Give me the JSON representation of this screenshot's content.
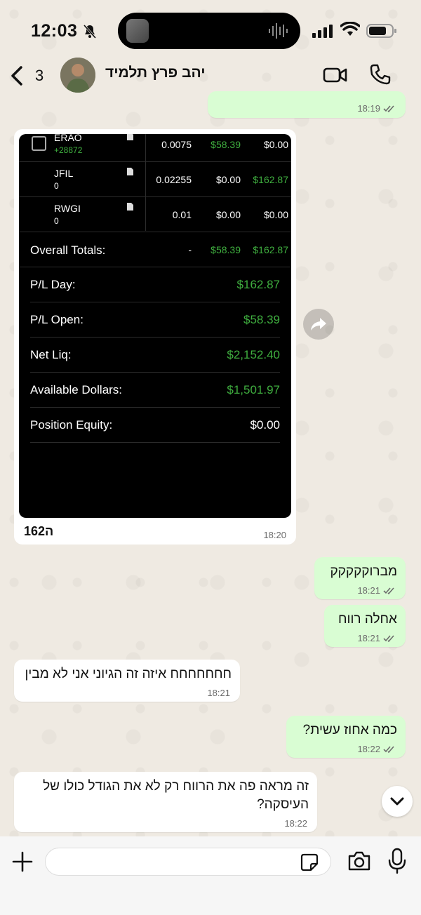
{
  "status_bar": {
    "time": "12:03"
  },
  "header": {
    "back_count": "3",
    "contact_name": "יהב פרץ תלמיד"
  },
  "messages": [
    {
      "dir": "out",
      "time": "18:19"
    },
    {
      "dir": "in",
      "type": "image",
      "caption": "ה162",
      "time": "18:20",
      "screenshot": {
        "positions": [
          {
            "symbol": "ERAO",
            "sub": "+28872",
            "qty": "0.0075",
            "pl_open": "$58.39",
            "pl_day": "$0.00"
          },
          {
            "symbol": "JFIL",
            "sub": "0",
            "qty": "0.02255",
            "pl_open": "$0.00",
            "pl_day": "$162.87"
          },
          {
            "symbol": "RWGI",
            "sub": "0",
            "qty": "0.01",
            "pl_open": "$0.00",
            "pl_day": "$0.00"
          }
        ],
        "totals": {
          "label": "Overall Totals:",
          "dash": "-",
          "pl_open": "$58.39",
          "pl_day": "$162.87"
        },
        "summary": [
          {
            "label": "P/L Day:",
            "value": "$162.87"
          },
          {
            "label": "P/L Open:",
            "value": "$58.39"
          },
          {
            "label": "Net Liq:",
            "value": "$2,152.40"
          },
          {
            "label": "Available Dollars:",
            "value": "$1,501.97"
          },
          {
            "label": "Position Equity:",
            "value": "$0.00"
          }
        ]
      }
    },
    {
      "dir": "out",
      "text": "מברוקקקקק",
      "time": "18:21"
    },
    {
      "dir": "out",
      "text": "אחלה רווח",
      "time": "18:21"
    },
    {
      "dir": "in",
      "text": "חחחחחחח איזה זה הגיוני אני לא מבין",
      "time": "18:21"
    },
    {
      "dir": "out",
      "text": "כמה אחוז עשית?",
      "time": "18:22"
    },
    {
      "dir": "in",
      "text": "זה מראה פה את הרווח רק לא את הגודל כולו של העיסקה?",
      "time": "18:22"
    }
  ],
  "colors": {
    "outgoing_bubble": "#d9fdd3",
    "incoming_bubble": "#ffffff",
    "profit_green": "#3fae3f",
    "read_ticks": "#53bdeb"
  },
  "icons": [
    "bell-slash-icon",
    "signal-icon",
    "wifi-icon",
    "battery-icon",
    "back-chevron-icon",
    "video-icon",
    "phone-icon",
    "share-icon",
    "chevron-down-icon",
    "plus-icon",
    "sticker-icon",
    "camera-icon",
    "mic-icon",
    "document-icon"
  ]
}
